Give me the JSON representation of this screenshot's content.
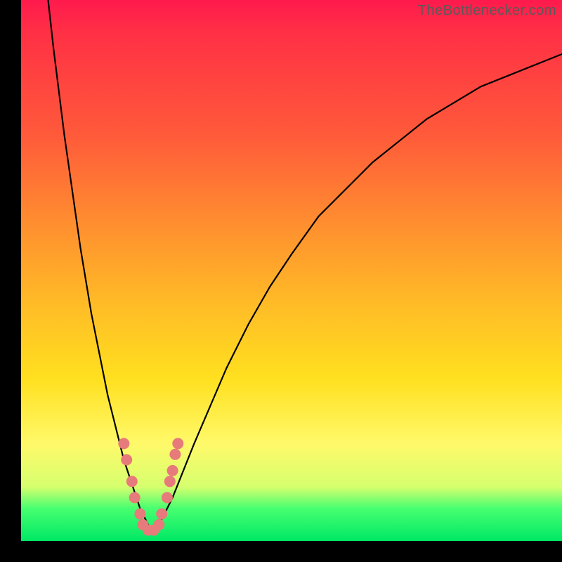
{
  "attribution": "TheBottlenecker.com",
  "colors": {
    "frame_bg": "#000000",
    "gradient_top": "#ff1a4d",
    "gradient_mid1": "#ff8a30",
    "gradient_mid2": "#ffe01f",
    "gradient_bottom": "#00e865",
    "curve_stroke": "#000000",
    "dot_fill": "#e77a7a"
  },
  "chart_data": {
    "type": "line",
    "title": "",
    "xlabel": "",
    "ylabel": "",
    "xlim": [
      0,
      100
    ],
    "ylim": [
      0,
      100
    ],
    "series": [
      {
        "name": "left_branch",
        "x": [
          5,
          6,
          7,
          8,
          9,
          10,
          11,
          12,
          13,
          14,
          15,
          16,
          17,
          18,
          19,
          20,
          21,
          22,
          23,
          24
        ],
        "y": [
          100,
          91,
          83,
          75,
          68,
          61,
          54,
          48,
          42,
          37,
          32,
          27,
          23,
          19,
          15,
          12,
          9,
          6,
          4,
          2
        ]
      },
      {
        "name": "right_branch",
        "x": [
          24,
          26,
          28,
          30,
          32,
          35,
          38,
          42,
          46,
          50,
          55,
          60,
          65,
          70,
          75,
          80,
          85,
          90,
          95,
          100
        ],
        "y": [
          2,
          4,
          8,
          13,
          18,
          25,
          32,
          40,
          47,
          53,
          60,
          65,
          70,
          74,
          78,
          81,
          84,
          86,
          88,
          90
        ]
      }
    ],
    "annotations": [],
    "legend": false,
    "grid": false,
    "markers": {
      "name": "highlight_dots",
      "note": "clustered near valley minimum on both branches",
      "points": [
        {
          "x": 19,
          "y": 18
        },
        {
          "x": 19.5,
          "y": 15
        },
        {
          "x": 20.5,
          "y": 11
        },
        {
          "x": 21,
          "y": 8
        },
        {
          "x": 22,
          "y": 5
        },
        {
          "x": 22.5,
          "y": 3
        },
        {
          "x": 23.5,
          "y": 2
        },
        {
          "x": 24.5,
          "y": 2
        },
        {
          "x": 25.5,
          "y": 3
        },
        {
          "x": 26,
          "y": 5
        },
        {
          "x": 27,
          "y": 8
        },
        {
          "x": 27.5,
          "y": 11
        },
        {
          "x": 28,
          "y": 13
        },
        {
          "x": 28.5,
          "y": 16
        },
        {
          "x": 29,
          "y": 18
        }
      ]
    }
  }
}
